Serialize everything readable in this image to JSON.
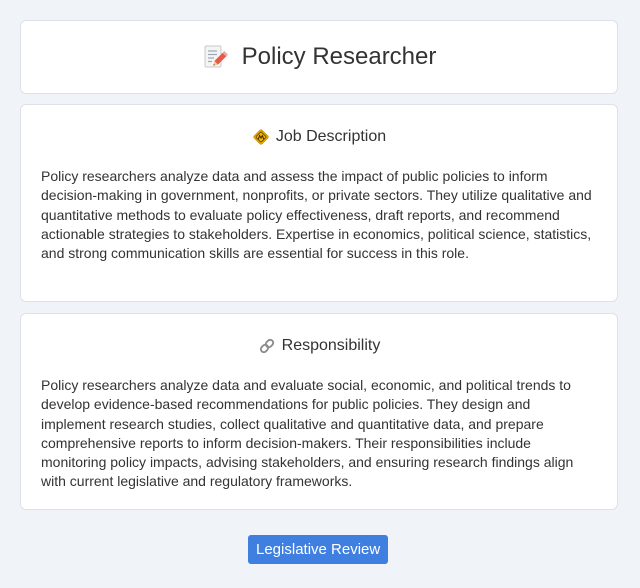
{
  "header": {
    "title": "Policy Researcher",
    "icon": "memo-icon"
  },
  "job_description": {
    "heading": "Job Description",
    "icon": "construction-sign-icon",
    "text": "Policy researchers analyze data and assess the impact of public policies to inform decision-making in government, nonprofits, or private sectors. They utilize qualitative and quantitative methods to evaluate policy effectiveness, draft reports, and recommend actionable strategies to stakeholders. Expertise in economics, political science, statistics, and strong communication skills are essential for success in this role."
  },
  "responsibility": {
    "heading": "Responsibility",
    "icon": "link-icon",
    "text": "Policy researchers analyze data and evaluate social, economic, and political trends to develop evidence-based recommendations for public policies. They design and implement research studies, collect qualitative and quantitative data, and prepare comprehensive reports to inform decision-makers. Their responsibilities include monitoring policy impacts, advising stakeholders, and ensuring research findings align with current legislative and regulatory frameworks."
  },
  "tag_button": {
    "label": "Legislative Review"
  },
  "colors": {
    "background": "#f0f3f8",
    "card": "#ffffff",
    "accent": "#3f7fe0",
    "text": "#333333"
  }
}
